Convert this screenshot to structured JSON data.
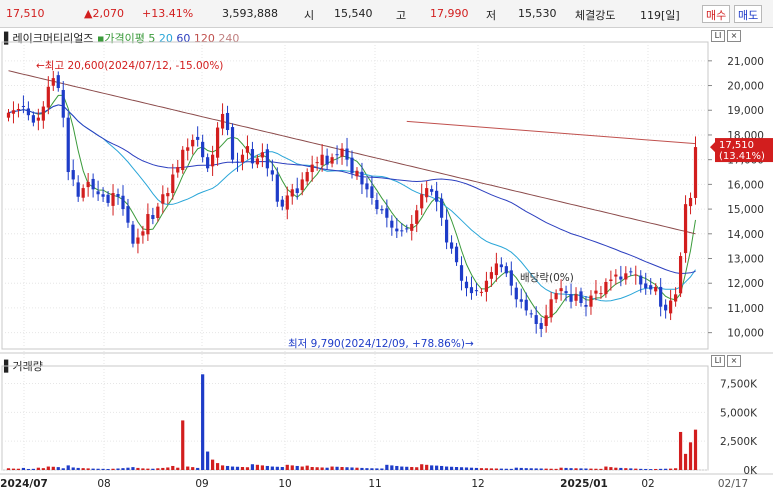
{
  "ticker": {
    "price": "17,510",
    "change": "▲2,070",
    "change_pct": "+13.41%",
    "volume": "3,593,888",
    "open_label": "시",
    "open": "15,540",
    "high_label": "고",
    "high": "17,990",
    "low_label": "저",
    "low": "15,530",
    "strength_label": "체결강도",
    "period": "119[일]",
    "buy_label": "매수",
    "sell_label": "매도"
  },
  "price_panel": {
    "name": "레이크머티리얼즈",
    "legend_prefix": "가격이평",
    "ma_periods": [
      "5",
      "20",
      "60",
      "120",
      "240"
    ],
    "ma_colors": [
      "#3a9a3a",
      "#2aa6d8",
      "#2c3fbf",
      "#c0504d",
      "#8b4a4a"
    ],
    "high_note": "←최고 20,600(2024/07/12, -15.00%)",
    "low_note": "최저 9,790(2024/12/09, +78.86%)→",
    "dividend_note": "배당락(0%)",
    "current_price": "17,510",
    "current_pct": "(13.41%)"
  },
  "volume_panel": {
    "title": "거래량"
  },
  "colors": {
    "up": "#d21e1e",
    "down": "#1e3cc8",
    "grid": "#e6e6e6"
  },
  "chart_data": [
    {
      "type": "candlestick",
      "title": "레이크머티리얼즈",
      "ylim": [
        9500,
        21600
      ],
      "y_ticks": [
        "21,000",
        "20,000",
        "19,000",
        "18,000",
        "17,000",
        "16,000",
        "15,000",
        "14,000",
        "13,000",
        "12,000",
        "11,000",
        "10,000"
      ],
      "x_ticks": [
        "2024/07",
        "08",
        "09",
        "10",
        "11",
        "12",
        "2025/01",
        "02",
        "02/17"
      ],
      "series_close": [
        18900,
        19000,
        19050,
        19150,
        18800,
        18500,
        18700,
        19150,
        19950,
        20300,
        19900,
        18700,
        16500,
        16200,
        15500,
        15850,
        16100,
        15800,
        15600,
        15500,
        15250,
        15650,
        15500,
        15000,
        14450,
        13600,
        13850,
        14100,
        14800,
        14600,
        15100,
        15600,
        15650,
        16400,
        16700,
        17400,
        17500,
        17800,
        17800,
        17100,
        16650,
        17200,
        18300,
        18850,
        18200,
        17000,
        16900,
        17200,
        17550,
        16850,
        17050,
        17300,
        16650,
        16400,
        15300,
        15100,
        15550,
        15800,
        15650,
        16200,
        16500,
        16800,
        16900,
        17200,
        16800,
        17100,
        17200,
        17450,
        17000,
        16450,
        16550,
        16000,
        15800,
        15450,
        15000,
        14950,
        14650,
        14250,
        14100,
        14100,
        14200,
        14400,
        14950,
        15600,
        15850,
        15700,
        15300,
        14650,
        13650,
        13400,
        12850,
        12100,
        11800,
        11600,
        11700,
        11650,
        12100,
        12450,
        12800,
        12650,
        12400,
        11900,
        11350,
        11250,
        10900,
        10750,
        10350,
        10150,
        10700,
        11350,
        11600,
        11800,
        11600,
        11250,
        11550,
        11200,
        11050,
        11500,
        11700,
        11600,
        12050,
        12150,
        12350,
        12150,
        12400,
        12450,
        12350,
        11950,
        11800,
        11750,
        11850,
        11050,
        10900,
        11300,
        11550,
        13100,
        15200,
        15450,
        17510
      ],
      "volume_ylim": [
        0,
        8500
      ],
      "volume_ticks": [
        "7,500K",
        "5,000K",
        "2,500K",
        "0K"
      ],
      "volume_series": [
        150,
        120,
        110,
        180,
        90,
        100,
        200,
        160,
        300,
        280,
        250,
        150,
        400,
        220,
        180,
        160,
        140,
        120,
        110,
        100,
        90,
        110,
        130,
        160,
        200,
        250,
        180,
        140,
        120,
        110,
        150,
        180,
        220,
        350,
        200,
        4300,
        300,
        250,
        180,
        8300,
        1600,
        900,
        600,
        400,
        350,
        300,
        280,
        260,
        240,
        500,
        450,
        400,
        350,
        300,
        280,
        260,
        450,
        400,
        350,
        300,
        380,
        260,
        240,
        220,
        200,
        300,
        280,
        260,
        240,
        220,
        200,
        180,
        160,
        150,
        140,
        130,
        450,
        400,
        350,
        300,
        280,
        260,
        240,
        500,
        450,
        400,
        380,
        350,
        300,
        280,
        260,
        240,
        220,
        200,
        180,
        160,
        150,
        140,
        130,
        120,
        110,
        100,
        200,
        180,
        160,
        150,
        140,
        130,
        120,
        110,
        100,
        200,
        180,
        160,
        150,
        140,
        130,
        120,
        110,
        100,
        300,
        250,
        200,
        180,
        160,
        140,
        120,
        100,
        90,
        80,
        90,
        100,
        110,
        120,
        150,
        3300,
        1400,
        2400,
        3500
      ]
    }
  ]
}
